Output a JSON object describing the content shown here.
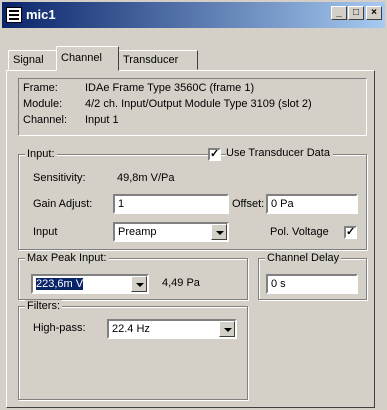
{
  "window": {
    "title": "mic1"
  },
  "caption_buttons": {
    "minimize": "_",
    "maximize": "□",
    "close": "×"
  },
  "tabs": [
    {
      "label": "Signal"
    },
    {
      "label": "Channel"
    },
    {
      "label": "Transducer"
    }
  ],
  "info": {
    "frame_label": "Frame:",
    "frame_value": "IDAe Frame Type 3560C (frame 1)",
    "module_label": "Module:",
    "module_value": "4/2 ch. Input/Output Module Type 3109 (slot 2)",
    "channel_label": "Channel:",
    "channel_value": "Input 1"
  },
  "input_group": {
    "title": "Input:",
    "use_transducer_label": "Use Transducer Data",
    "use_transducer_checked": "✓",
    "sensitivity_label": "Sensitivity:",
    "sensitivity_value": "49,8m V/Pa",
    "gain_label": "Gain Adjust:",
    "gain_value": "1",
    "offset_label": "Offset:",
    "offset_value": "0 Pa",
    "input_label": "Input",
    "input_value": "Preamp",
    "pol_voltage_label": "Pol. Voltage",
    "pol_voltage_checked": "✓"
  },
  "max_peak": {
    "title": "Max Peak Input:",
    "value": "223,6m V",
    "readout": "4,49 Pa"
  },
  "channel_delay": {
    "title": "Channel Delay",
    "value": "0 s"
  },
  "filters": {
    "title": "Filters:",
    "highpass_label": "High-pass:",
    "highpass_value": "22.4 Hz"
  }
}
